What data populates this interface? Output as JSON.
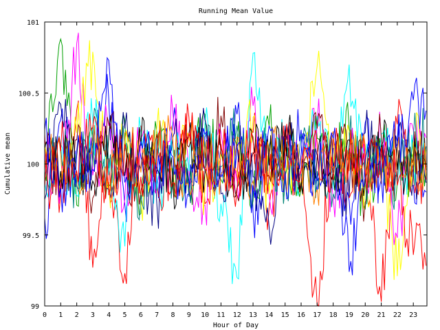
{
  "chart_data": {
    "type": "line",
    "title": "Running Mean Value",
    "xlabel": "Hour of Day",
    "ylabel": "Cumulative mean",
    "xlim": [
      0,
      23.85
    ],
    "ylim": [
      99,
      101
    ],
    "x_ticks": [
      "0",
      "1",
      "2",
      "3",
      "4",
      "5",
      "6",
      "7",
      "8",
      "9",
      "10",
      "11",
      "12",
      "13",
      "14",
      "15",
      "16",
      "17",
      "18",
      "19",
      "20",
      "21",
      "22",
      "23"
    ],
    "y_ticks": [
      "99",
      "99.5",
      "100",
      "100.5",
      "101"
    ],
    "grid": false,
    "legend": "none",
    "series_colors": [
      "#0000ff",
      "#ff0000",
      "#00a000",
      "#ff00ff",
      "#00ffff",
      "#ffff00",
      "#000080",
      "#800000",
      "#008080",
      "#000000",
      "#ff8000"
    ],
    "series": [
      {
        "color": "#0000ff",
        "values": [
          99.62,
          100.31,
          99.84,
          100.12,
          100.46,
          99.71,
          100.05,
          99.88,
          100.28,
          99.77,
          100.19,
          99.93,
          100.35,
          99.66,
          100.08,
          99.97,
          100.24,
          99.81,
          100.11,
          99.74,
          100.29,
          99.9,
          100.16,
          99.85
        ]
      },
      {
        "color": "#ff0000",
        "values": [
          100.21,
          99.79,
          100.38,
          99.27,
          100.04,
          99.23,
          100.27,
          99.86,
          99.95,
          100.33,
          99.72,
          100.14,
          99.88,
          100.22,
          99.69,
          100.09,
          99.83,
          99.01,
          100.19,
          99.76,
          100.05,
          99.03,
          100.28,
          99.94
        ]
      },
      {
        "color": "#00a000",
        "values": [
          99.94,
          100.88,
          99.71,
          100.16,
          99.84,
          100.31,
          99.65,
          100.22,
          99.97,
          99.78,
          100.35,
          99.89,
          100.12,
          99.74,
          100.27,
          99.91,
          99.82,
          100.18,
          99.96,
          100.24,
          99.68,
          100.11,
          99.87,
          100.02
        ]
      },
      {
        "color": "#ff00ff",
        "values": [
          100.08,
          99.86,
          100.85,
          99.92,
          100.27,
          99.75,
          100.18,
          99.83,
          100.36,
          99.95,
          99.71,
          100.22,
          99.89,
          100.41,
          99.79,
          100.13,
          99.97,
          100.29,
          99.77,
          100.06,
          99.91,
          100.17,
          99.48,
          100.24
        ]
      },
      {
        "color": "#00ffff",
        "values": [
          99.87,
          100.14,
          99.78,
          100.31,
          99.92,
          99.42,
          100.23,
          99.81,
          100.09,
          99.95,
          100.28,
          99.72,
          99.2,
          100.78,
          99.86,
          100.17,
          99.93,
          100.34,
          99.82,
          100.7,
          99.96,
          100.21,
          99.88,
          100.05
        ]
      },
      {
        "color": "#ffff00",
        "values": [
          100.15,
          99.93,
          100.22,
          100.79,
          99.86,
          100.11,
          99.74,
          100.26,
          99.91,
          100.18,
          99.83,
          100.07,
          99.95,
          100.33,
          99.79,
          100.12,
          99.88,
          100.69,
          99.97,
          100.23,
          99.85,
          100.09,
          99.21,
          100.16
        ]
      },
      {
        "color": "#000080",
        "values": [
          99.75,
          100.42,
          99.93,
          100.08,
          99.82,
          100.25,
          99.97,
          99.71,
          100.19,
          99.88,
          100.31,
          99.79,
          100.14,
          99.91,
          99.56,
          100.27,
          99.84,
          100.06,
          99.98,
          99.77,
          100.22,
          99.89,
          100.11,
          99.93
        ]
      },
      {
        "color": "#800000",
        "values": [
          100.02,
          99.89,
          100.17,
          99.76,
          100.29,
          99.94,
          99.81,
          100.21,
          99.87,
          100.12,
          99.96,
          100.34,
          99.78,
          100.08,
          99.92,
          100.18,
          99.85,
          100.25,
          99.97,
          100.11,
          99.73,
          100.19,
          99.91,
          100.04
        ]
      },
      {
        "color": "#008080",
        "values": [
          99.91,
          100.12,
          99.85,
          100.24,
          99.97,
          100.09,
          99.78,
          100.18,
          99.93,
          99.84,
          100.16,
          99.98,
          100.27,
          99.81,
          100.13,
          99.89,
          100.21,
          99.95,
          99.79,
          100.14,
          99.92,
          100.07,
          99.86,
          100.19
        ]
      },
      {
        "color": "#000000",
        "values": [
          100.11,
          99.95,
          100.06,
          99.88,
          100.19,
          99.92,
          100.13,
          99.97,
          99.86,
          100.21,
          99.94,
          100.08,
          99.83,
          100.16,
          99.99,
          100.24,
          99.87,
          100.05,
          99.93,
          100.17,
          99.89,
          100.12,
          99.96,
          100.03
        ]
      },
      {
        "color": "#ff8000",
        "values": [
          99.96,
          100.07,
          99.91,
          100.15,
          99.87,
          100.22,
          99.94,
          100.09,
          100.17,
          99.85,
          100.04,
          99.93,
          100.19,
          99.88,
          100.11,
          99.97,
          100.06,
          99.82,
          100.23,
          99.95,
          100.13,
          99.86,
          100.08,
          99.99
        ]
      },
      {
        "color": "#0000ff",
        "values": [
          100.24,
          99.83,
          100.09,
          99.96,
          100.73,
          99.87,
          100.16,
          99.93,
          100.05,
          99.79,
          100.21,
          99.91,
          100.12,
          99.85,
          100.27,
          99.95,
          100.07,
          99.88,
          100.18,
          99.24,
          100.03,
          99.92,
          100.14,
          100.45
        ]
      },
      {
        "color": "#ff0000",
        "values": [
          99.83,
          100.09,
          99.95,
          100.26,
          99.78,
          100.14,
          99.91,
          100.05,
          99.87,
          100.22,
          99.97,
          100.11,
          99.82,
          100.19,
          99.93,
          100.08,
          99.96,
          100.15,
          99.89,
          100.03,
          99.94,
          100.12,
          99.85,
          99.36
        ]
      }
    ]
  }
}
